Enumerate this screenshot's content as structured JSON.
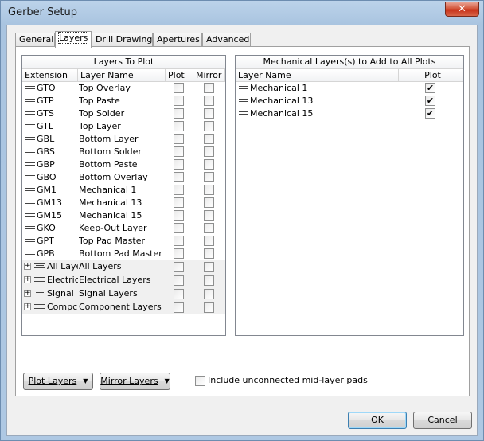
{
  "window": {
    "title": "Gerber Setup",
    "close_glyph": "✕"
  },
  "tabs": [
    "General",
    "Layers",
    "Drill Drawing",
    "Apertures",
    "Advanced"
  ],
  "layers_grid": {
    "title": "Layers To Plot",
    "columns": {
      "extension": "Extension",
      "layer_name": "Layer Name",
      "plot": "Plot",
      "mirror": "Mirror"
    },
    "rows": [
      {
        "ext": "GTO",
        "name": "Top Overlay",
        "plot": false,
        "mirror": false
      },
      {
        "ext": "GTP",
        "name": "Top Paste",
        "plot": false,
        "mirror": false
      },
      {
        "ext": "GTS",
        "name": "Top Solder",
        "plot": false,
        "mirror": false
      },
      {
        "ext": "GTL",
        "name": "Top Layer",
        "plot": false,
        "mirror": false
      },
      {
        "ext": "GBL",
        "name": "Bottom Layer",
        "plot": false,
        "mirror": false
      },
      {
        "ext": "GBS",
        "name": "Bottom Solder",
        "plot": false,
        "mirror": false
      },
      {
        "ext": "GBP",
        "name": "Bottom Paste",
        "plot": false,
        "mirror": false
      },
      {
        "ext": "GBO",
        "name": "Bottom Overlay",
        "plot": false,
        "mirror": false
      },
      {
        "ext": "GM1",
        "name": "Mechanical 1",
        "plot": false,
        "mirror": false
      },
      {
        "ext": "GM13",
        "name": "Mechanical 13",
        "plot": false,
        "mirror": false
      },
      {
        "ext": "GM15",
        "name": "Mechanical 15",
        "plot": false,
        "mirror": false
      },
      {
        "ext": "GKO",
        "name": "Keep-Out Layer",
        "plot": false,
        "mirror": false
      },
      {
        "ext": "GPT",
        "name": "Top Pad Master",
        "plot": false,
        "mirror": false
      },
      {
        "ext": "GPB",
        "name": "Bottom Pad Master",
        "plot": false,
        "mirror": false
      }
    ],
    "groups": [
      {
        "ext": "All Laye",
        "name": "All Layers"
      },
      {
        "ext": "Electric",
        "name": "Electrical Layers"
      },
      {
        "ext": "Signal",
        "name": "Signal Layers"
      },
      {
        "ext": "Compc",
        "name": "Component Layers"
      }
    ]
  },
  "mech_grid": {
    "title": "Mechanical Layers(s) to Add to All Plots",
    "columns": {
      "layer_name": "Layer Name",
      "plot": "Plot"
    },
    "rows": [
      {
        "name": "Mechanical 1",
        "plot": true
      },
      {
        "name": "Mechanical 13",
        "plot": true
      },
      {
        "name": "Mechanical 15",
        "plot": true
      }
    ]
  },
  "buttons": {
    "plot_layers": "Plot Layers",
    "mirror_layers": "Mirror Layers",
    "ok": "OK",
    "cancel": "Cancel"
  },
  "include_unconnected": {
    "label": "Include unconnected mid-layer pads",
    "checked": false
  },
  "check_glyph": "✔",
  "expander_glyph": "+",
  "dropdown_glyph": "▼"
}
